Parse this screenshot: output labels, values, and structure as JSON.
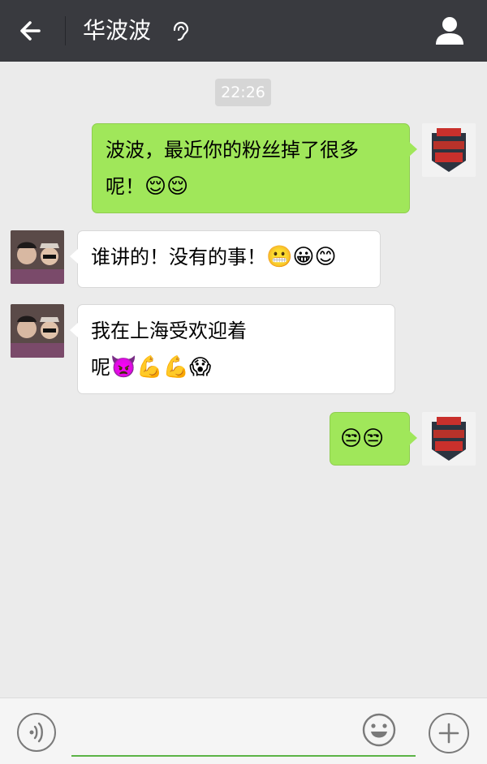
{
  "header": {
    "title": "华波波",
    "back_icon": "back-arrow-icon",
    "ear_icon": "earpiece-mode-icon",
    "profile_icon": "person-icon",
    "background": "#393a3f"
  },
  "chat": {
    "timestamp": "22:26",
    "messages": [
      {
        "side": "right",
        "text": "波波，最近你的粉丝掉了很多",
        "text2": "呢！",
        "emoji": "😌😌"
      },
      {
        "side": "left",
        "text": "谁讲的！没有的事！",
        "emoji": "😬😀😊"
      },
      {
        "side": "left",
        "text": "我在上海受欢迎着",
        "text2": "呢",
        "emoji": "👿💪💪😱"
      },
      {
        "side": "right",
        "emoji": "😒😒"
      }
    ],
    "colors": {
      "sent_bubble": "#a0e75a",
      "received_bubble": "#ffffff",
      "background": "#ebebeb"
    }
  },
  "input_bar": {
    "voice_icon": "voice-icon",
    "emoji_icon": "smiley-icon",
    "plus_icon": "plus-icon"
  }
}
